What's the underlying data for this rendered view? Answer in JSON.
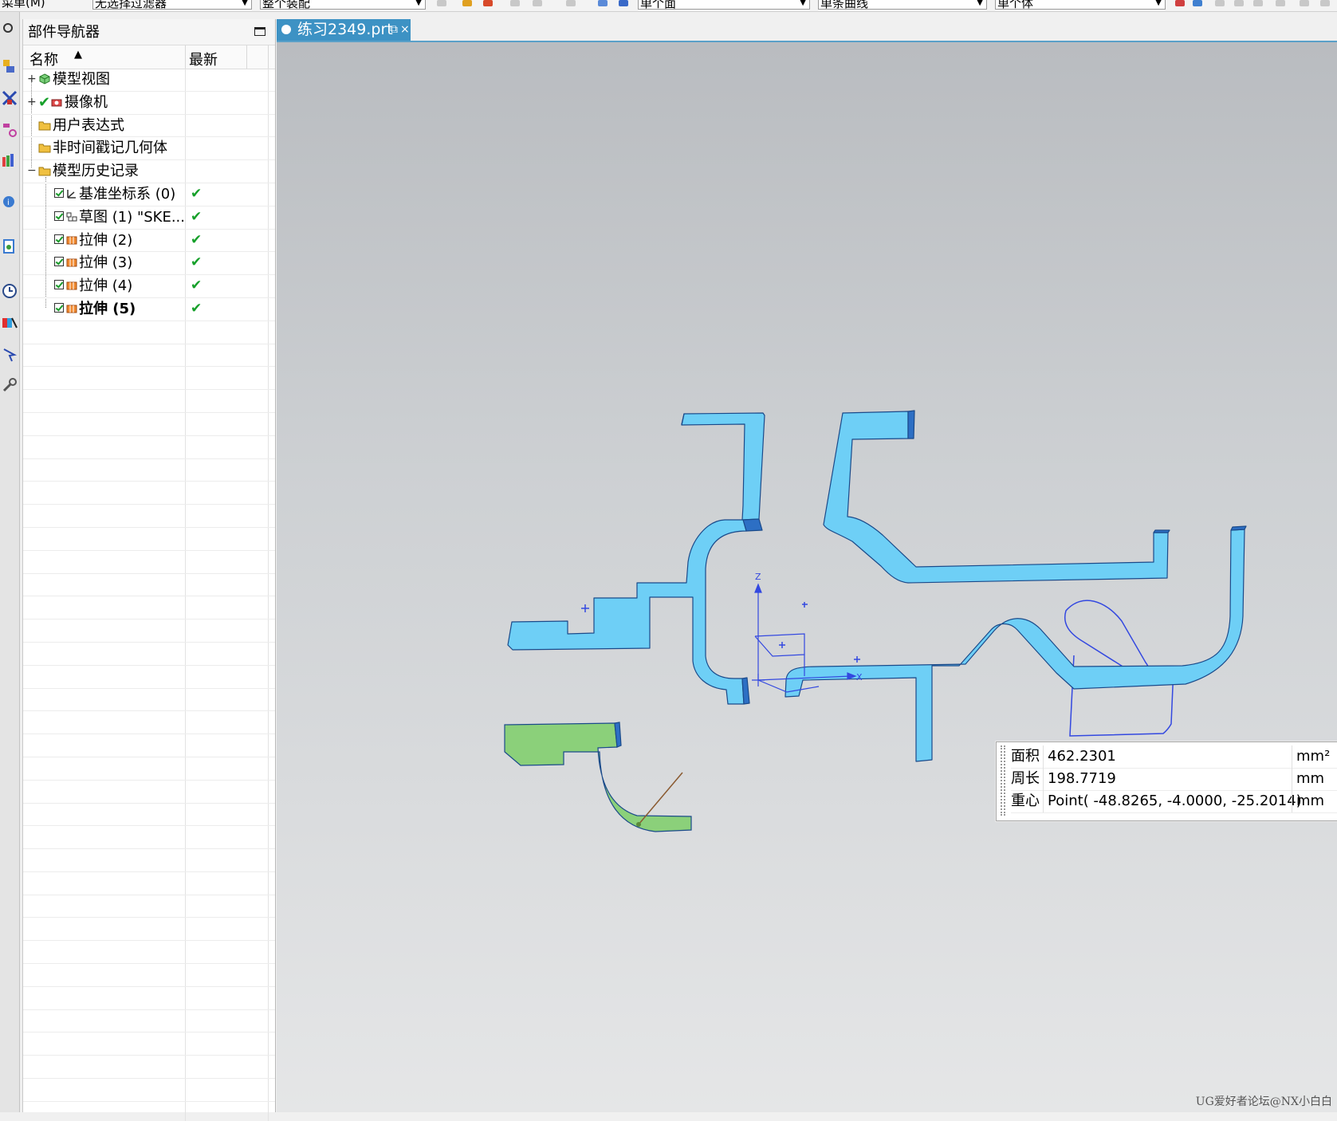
{
  "toolbar": {
    "menu_label": "菜单(M)",
    "selection_filter": "无选择过滤器",
    "assembly_scope": "整个装配",
    "face_rule": "单个面",
    "curve_rule": "单条曲线",
    "body_rule": "单个体"
  },
  "navigator": {
    "title": "部件导航器",
    "columns": {
      "name": "名称",
      "latest": "最新"
    },
    "items": [
      {
        "label": "模型视图",
        "expander": "+",
        "icon": "model-views-icon"
      },
      {
        "label": "摄像机",
        "expander": "+",
        "icon": "camera-icon"
      },
      {
        "label": "用户表达式",
        "icon": "folder-icon"
      },
      {
        "label": "非时间戳记几何体",
        "icon": "folder-icon"
      },
      {
        "label": "模型历史记录",
        "expander": "−",
        "icon": "folder-icon"
      }
    ],
    "history": [
      {
        "label": "基准坐标系 (0)",
        "icon": "datum-csys-icon",
        "latest": "✔"
      },
      {
        "label": "草图 (1) \"SKE...",
        "icon": "sketch-icon",
        "latest": "✔"
      },
      {
        "label": "拉伸 (2)",
        "icon": "extrude-icon",
        "latest": "✔"
      },
      {
        "label": "拉伸 (3)",
        "icon": "extrude-icon",
        "latest": "✔"
      },
      {
        "label": "拉伸 (4)",
        "icon": "extrude-icon",
        "latest": "✔"
      },
      {
        "label": "拉伸 (5)",
        "icon": "extrude-icon",
        "latest": "✔",
        "bold": true
      }
    ]
  },
  "tab": {
    "label": "练习2349.prt",
    "pin_glyph": "⧉",
    "close_glyph": "×"
  },
  "viewport": {
    "axis_labels": {
      "z": "Z",
      "x": "X"
    },
    "colors": {
      "solid": "#6ecff6",
      "selected_face": "#8bd07a",
      "sketch": "#3348e0"
    }
  },
  "measure": {
    "rows": [
      {
        "label": "面积",
        "value": "462.2301",
        "unit": "mm²"
      },
      {
        "label": "周长",
        "value": "198.7719",
        "unit": "mm"
      },
      {
        "label": "重心",
        "value": "Point( -48.8265, -4.0000, -25.2014)",
        "unit": "mm"
      }
    ]
  },
  "watermark": "UG爱好者论坛@NX小白白"
}
